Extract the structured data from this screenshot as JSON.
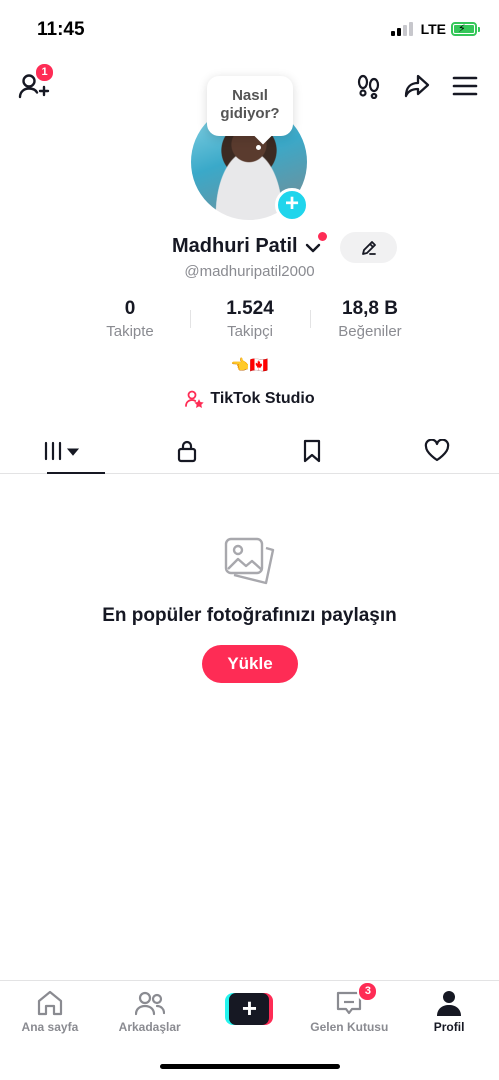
{
  "status_bar": {
    "time": "11:45",
    "network": "LTE",
    "battery_color": "#34c759"
  },
  "top_bar": {
    "friend_requests_badge": "1"
  },
  "profile": {
    "bubble_text": "Nasıl gidiyor?",
    "name": "Madhuri Patil",
    "username": "@madhuripatil2000",
    "bio": "👈🇨🇦",
    "studio_label": "TikTok Studio"
  },
  "stats": [
    {
      "value": "0",
      "label": "Takipte"
    },
    {
      "value": "1.524",
      "label": "Takipçi"
    },
    {
      "value": "18,8 B",
      "label": "Beğeniler"
    }
  ],
  "empty_state": {
    "title": "En popüler fotoğrafınızı paylaşın",
    "button": "Yükle"
  },
  "bottom_nav": [
    {
      "label": "Ana sayfa",
      "icon": "home-icon"
    },
    {
      "label": "Arkadaşlar",
      "icon": "friends-icon"
    },
    {
      "label": "",
      "icon": "create-icon"
    },
    {
      "label": "Gelen Kutusu",
      "icon": "inbox-icon",
      "badge": "3"
    },
    {
      "label": "Profil",
      "icon": "profile-icon"
    }
  ],
  "colors": {
    "accent": "#fe2c55",
    "cyan": "#20d5ec",
    "text": "#161823",
    "muted": "#8a8b91"
  }
}
